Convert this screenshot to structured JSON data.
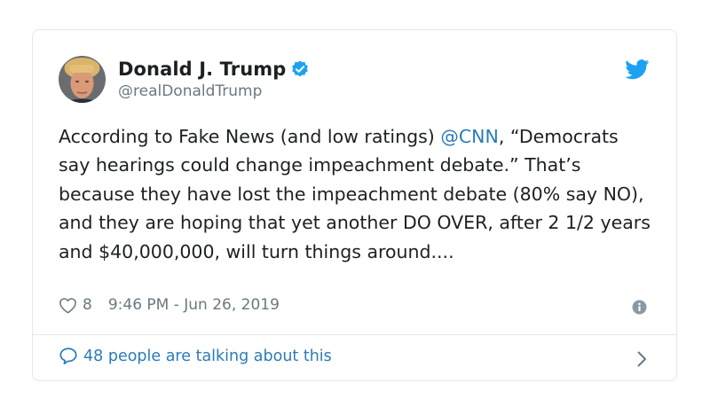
{
  "author": {
    "name": "Donald J. Trump",
    "handle": "@realDonaldTrump",
    "verified": true
  },
  "tweet": {
    "text_before_mention": "According to Fake News (and low ratings) ",
    "mention": "@CNN",
    "text_after_mention": ", “Democrats say hearings could change impeachment debate.” That’s because they have lost the impeachment debate (80% say NO), and they are hoping that yet another DO OVER, after 2 1/2 years and $40,000,000, will turn things around...."
  },
  "meta": {
    "like_count": "8",
    "timestamp": "9:46 PM - Jun 26, 2019"
  },
  "footer": {
    "talking_label": "48 people are talking about this"
  },
  "icons": {
    "avatar": "avatar-photo",
    "verified": "verified-badge-icon",
    "brand": "twitter-bird-icon",
    "like": "heart-icon",
    "info": "info-icon",
    "reply": "speech-bubble-icon",
    "chevron": "chevron-right-icon"
  },
  "colors": {
    "brand_blue": "#1da1f2",
    "link_blue": "#2b7bb9",
    "muted_text": "#697882",
    "border": "#e1e8ed",
    "text": "#1c2022"
  }
}
